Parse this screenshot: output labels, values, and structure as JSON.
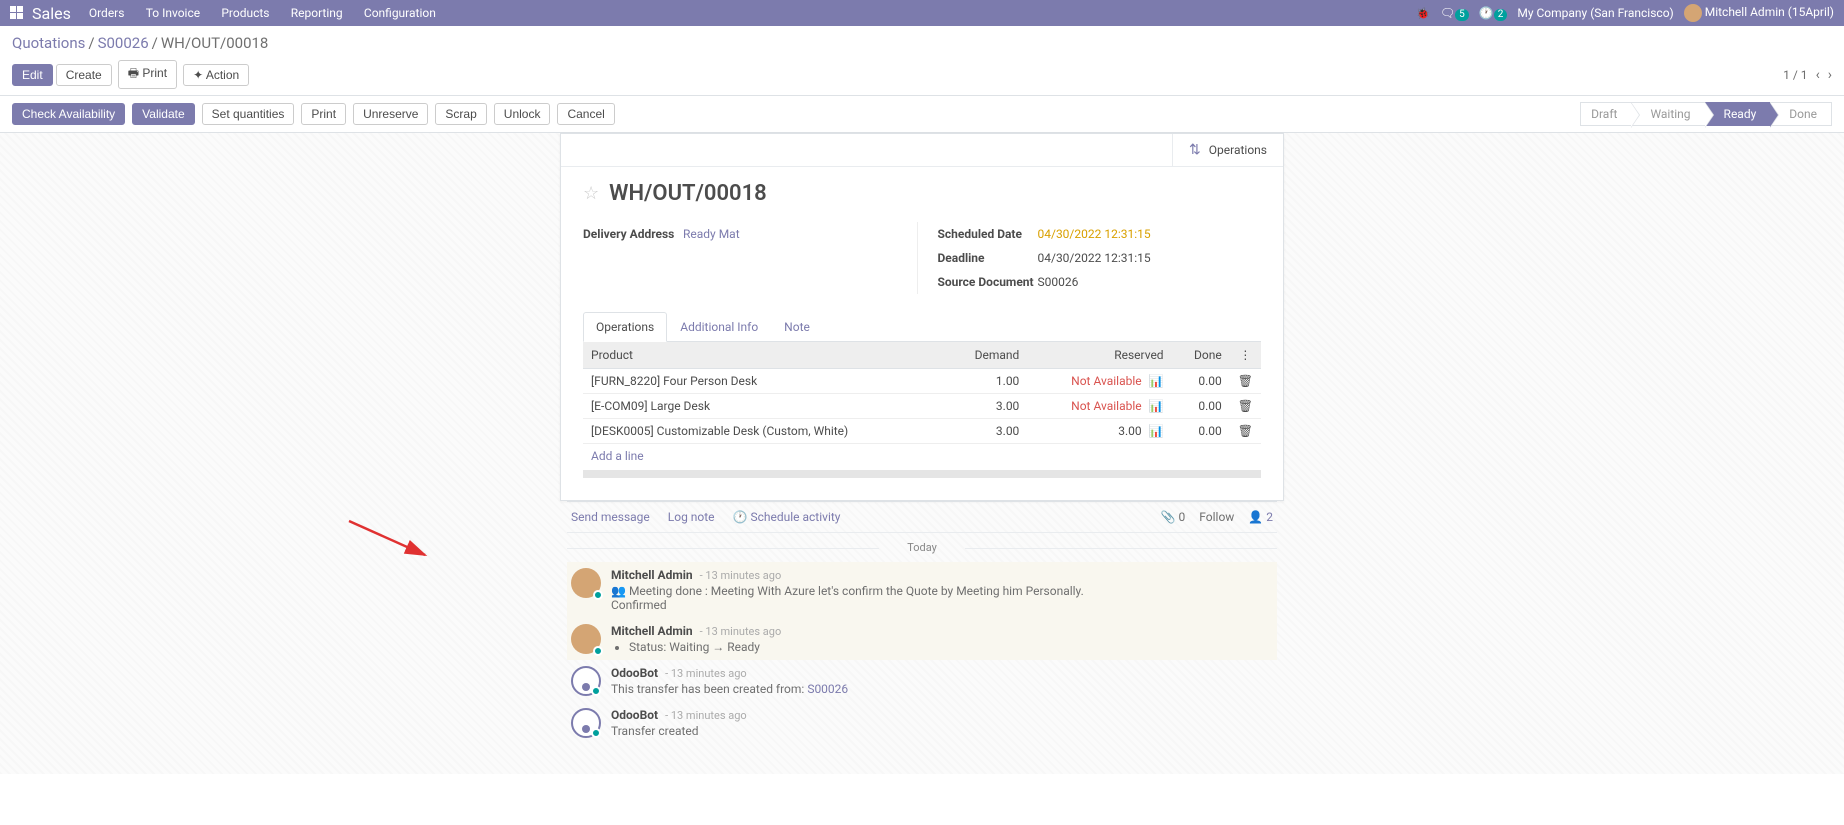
{
  "topnav": {
    "brand": "Sales",
    "menu": [
      "Orders",
      "To Invoice",
      "Products",
      "Reporting",
      "Configuration"
    ],
    "msg_badge": "5",
    "clock_badge": "2",
    "company": "My Company (San Francisco)",
    "user": "Mitchell Admin (15April)"
  },
  "breadcrumb": {
    "root": "Quotations",
    "mid": "S00026",
    "current": "WH/OUT/00018"
  },
  "buttons": {
    "edit": "Edit",
    "create": "Create",
    "print": "Print",
    "action": "Action",
    "check": "Check Availability",
    "validate": "Validate",
    "setq": "Set quantities",
    "print2": "Print",
    "unreserve": "Unreserve",
    "scrap": "Scrap",
    "unlock": "Unlock",
    "cancel": "Cancel"
  },
  "pager": "1 / 1",
  "status": {
    "draft": "Draft",
    "waiting": "Waiting",
    "ready": "Ready",
    "done": "Done"
  },
  "ops_button": "Operations",
  "doc_title": "WH/OUT/00018",
  "fields": {
    "delivery_label": "Delivery Address",
    "delivery_val": "Ready Mat",
    "sched_label": "Scheduled Date",
    "sched_val": "04/30/2022 12:31:15",
    "deadline_label": "Deadline",
    "deadline_val": "04/30/2022 12:31:15",
    "source_label": "Source Document",
    "source_val": "S00026"
  },
  "tabs": {
    "ops": "Operations",
    "addl": "Additional Info",
    "note": "Note"
  },
  "table": {
    "h_product": "Product",
    "h_demand": "Demand",
    "h_reserved": "Reserved",
    "h_done": "Done",
    "rows": [
      {
        "product": "[FURN_8220] Four Person Desk",
        "demand": "1.00",
        "reserved": "Not Available",
        "done": "0.00",
        "navail": true
      },
      {
        "product": "[E-COM09] Large Desk",
        "demand": "3.00",
        "reserved": "Not Available",
        "done": "0.00",
        "navail": true
      },
      {
        "product": "[DESK0005] Customizable Desk (Custom, White)",
        "demand": "3.00",
        "reserved": "3.00",
        "done": "0.00",
        "navail": false
      }
    ],
    "add_line": "Add a line"
  },
  "chatter": {
    "send": "Send message",
    "log": "Log note",
    "sched": "Schedule activity",
    "attach": "0",
    "follow": "Follow",
    "followers": "2",
    "today": "Today",
    "msgs": [
      {
        "author": "Mitchell Admin",
        "time": "- 13 minutes ago",
        "type": "note",
        "lines": [
          "Meeting done : Meeting With Azure let's confirm the Quote by Meeting him Personally.",
          "Confirmed"
        ],
        "people_icon": true
      },
      {
        "author": "Mitchell Admin",
        "time": "- 13 minutes ago",
        "type": "note",
        "status_change": {
          "prefix": "Status:",
          "from": "Waiting",
          "to": "Ready"
        }
      },
      {
        "author": "OdooBot",
        "time": "- 13 minutes ago",
        "type": "plain",
        "text_parts": [
          "This transfer has been created from: ",
          "S00026"
        ],
        "bot": true
      },
      {
        "author": "OdooBot",
        "time": "- 13 minutes ago",
        "type": "plain",
        "text": "Transfer created",
        "bot": true
      }
    ]
  }
}
